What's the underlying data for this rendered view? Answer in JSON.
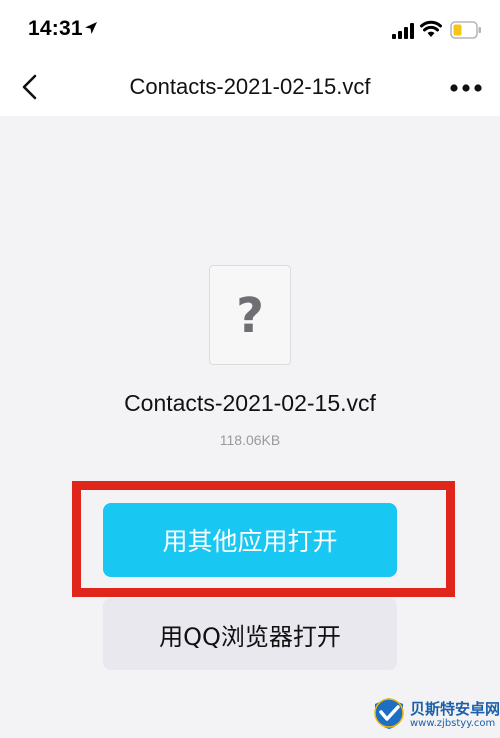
{
  "status_bar": {
    "time": "14:31",
    "icons": [
      "location-arrow-icon",
      "cellular-signal-icon",
      "wifi-icon",
      "battery-low-icon"
    ],
    "battery_color": "#f5c518"
  },
  "nav": {
    "back_icon": "chevron-left-icon",
    "title": "Contacts-2021-02-15.vcf",
    "more_icon": "more-dots-icon"
  },
  "file": {
    "icon": "unknown-file-icon",
    "icon_glyph": "?",
    "name": "Contacts-2021-02-15.vcf",
    "size": "118.06KB"
  },
  "actions": {
    "open_other_label": "用其他应用打开",
    "open_qq_label": "用QQ浏览器打开"
  },
  "colors": {
    "primary_button": "#19c7f3",
    "secondary_button": "#e8e8ee",
    "highlight": "#e0261b",
    "background": "#f3f3f5"
  },
  "watermark": {
    "name": "贝斯特安卓网",
    "url": "www.zjbstyy.com"
  }
}
